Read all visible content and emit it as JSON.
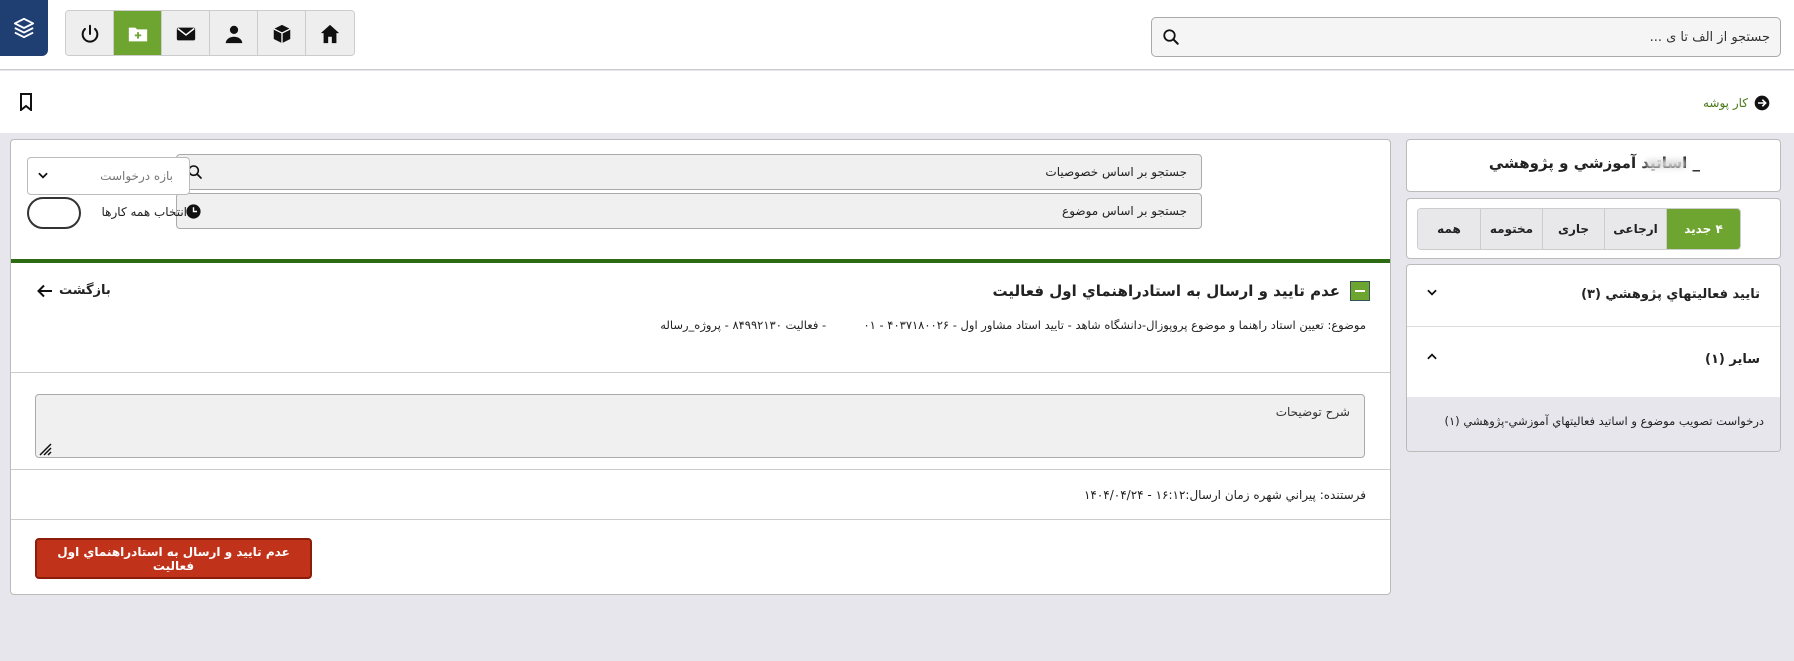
{
  "header": {
    "search_placeholder": "جستجو از الف تا ی ...",
    "icons": [
      "power-icon",
      "folder-add-icon",
      "mail-icon",
      "user-icon",
      "box-icon",
      "home-icon"
    ],
    "active_icon": "folder-add-icon",
    "accent_color": "#6ea531"
  },
  "subbar": {
    "workfolder_label": "کار پوشه"
  },
  "filters": {
    "search_attributes_placeholder": "جستجو بر اساس خصوصیات",
    "search_subject_placeholder": "جستجو بر اساس موضوع",
    "range_dropdown": "بازه درخواست",
    "select_all_label": "انتخاب همه کارها"
  },
  "task": {
    "title": "عدم تایید و ارسال به استادراهنماي اول فعالیت",
    "back_label": "بازگشت",
    "subject": "موضوع: تعیین استاد راهنما و موضوع پروپوزال-دانشگاه شاهد - تایید استاد مشاور اول - ۴۰۳۷۱۸۰۰۲۶ - ۰۱",
    "subject_tail": "- فعالیت ۸۴۹۹۲۱۳۰ - پروژه_رساله",
    "description_placeholder": "شرح توضیحات",
    "sender": "فرستنده: پیراني شهره   زمان ارسال:۱۶:۱۲ - ۱۴۰۴/۰۴/۲۴",
    "action_button": "عدم تایید و ارسال به استادراهنماي اول فعالیت",
    "action_color": "#c1321a"
  },
  "sidebar": {
    "title": "_ اساتید آموزشي و پژوهشي",
    "tabs": [
      "۴ جدید",
      "ارجاعی",
      "جاری",
      "مختومه",
      "همه"
    ],
    "active_tab": "۴ جدید",
    "groups": [
      {
        "label": "تایید فعالیتهاي پژوهشي (۳)",
        "expanded": false
      },
      {
        "label": "سایر (۱)",
        "expanded": true
      }
    ],
    "sub_item": "درخواست تصویب موضوع و اساتید فعالیتهاي آموزشي-پژوهشي (۱)"
  }
}
